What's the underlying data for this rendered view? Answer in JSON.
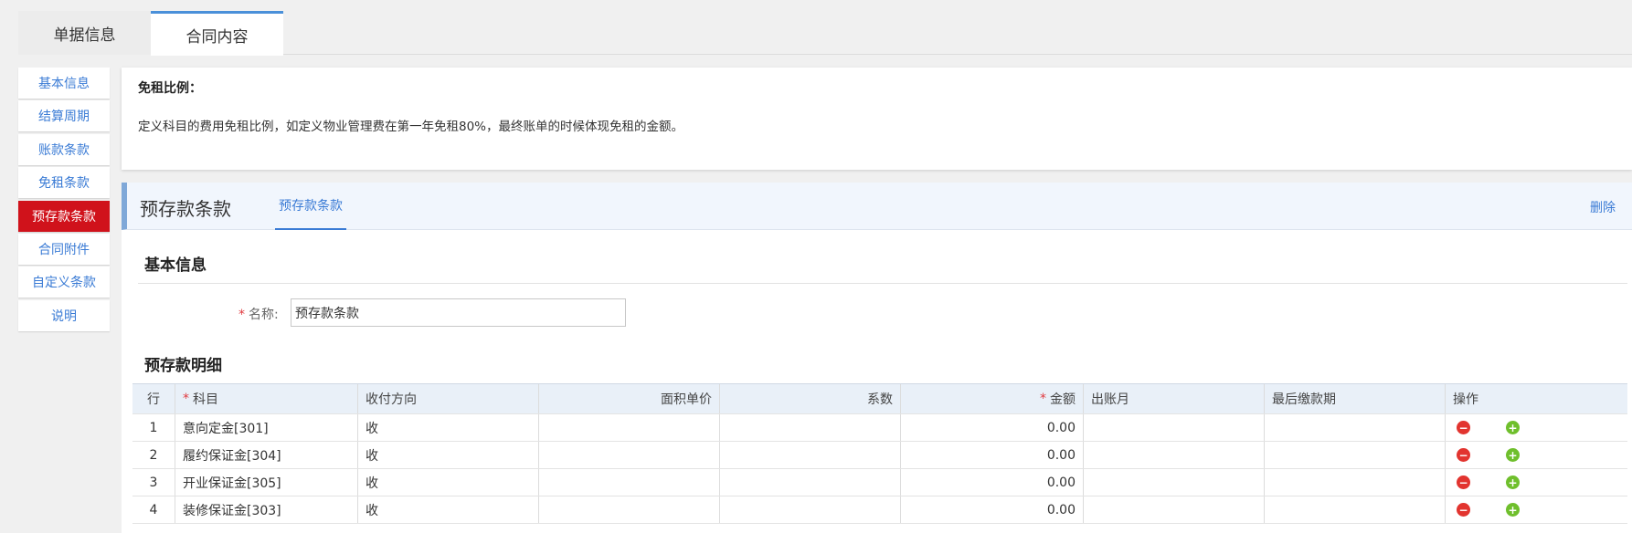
{
  "top_tabs": [
    {
      "label": "单据信息"
    },
    {
      "label": "合同内容"
    }
  ],
  "side_nav": [
    {
      "label": "基本信息"
    },
    {
      "label": "结算周期"
    },
    {
      "label": "账款条款"
    },
    {
      "label": "免租条款"
    },
    {
      "label": "预存款条款"
    },
    {
      "label": "合同附件"
    },
    {
      "label": "自定义条款"
    },
    {
      "label": "说明"
    }
  ],
  "info": {
    "title": "免租比例：",
    "desc": "定义科目的费用免租比例，如定义物业管理费在第一年免租80%，最终账单的时候体现免租的金额。"
  },
  "panel": {
    "title": "预存款条款",
    "subtab": "预存款条款",
    "delete_label": "删除",
    "basic_section": "基本信息",
    "name_label": "名称:",
    "name_value": "预存款条款",
    "detail_section": "预存款明细"
  },
  "table": {
    "headers": [
      "行",
      "科目",
      "收付方向",
      "面积单价",
      "系数",
      "金额",
      "出账月",
      "最后缴款期",
      "操作"
    ],
    "rows": [
      {
        "row": "1",
        "subject": "意向定金[301]",
        "direction": "收",
        "unit_price": "",
        "factor": "",
        "amount": "0.00",
        "bill_month": "",
        "last_due": ""
      },
      {
        "row": "2",
        "subject": "履约保证金[304]",
        "direction": "收",
        "unit_price": "",
        "factor": "",
        "amount": "0.00",
        "bill_month": "",
        "last_due": ""
      },
      {
        "row": "3",
        "subject": "开业保证金[305]",
        "direction": "收",
        "unit_price": "",
        "factor": "",
        "amount": "0.00",
        "bill_month": "",
        "last_due": ""
      },
      {
        "row": "4",
        "subject": "装修保证金[303]",
        "direction": "收",
        "unit_price": "",
        "factor": "",
        "amount": "0.00",
        "bill_month": "",
        "last_due": ""
      }
    ]
  },
  "icons": {
    "remove": "minus-circle-icon",
    "add": "plus-circle-icon"
  },
  "colors": {
    "active_nav": "#d0121b",
    "link": "#3a7bd5",
    "required": "#e0393e",
    "remove_icon": "#e2342f",
    "add_icon": "#6fbf2c"
  }
}
